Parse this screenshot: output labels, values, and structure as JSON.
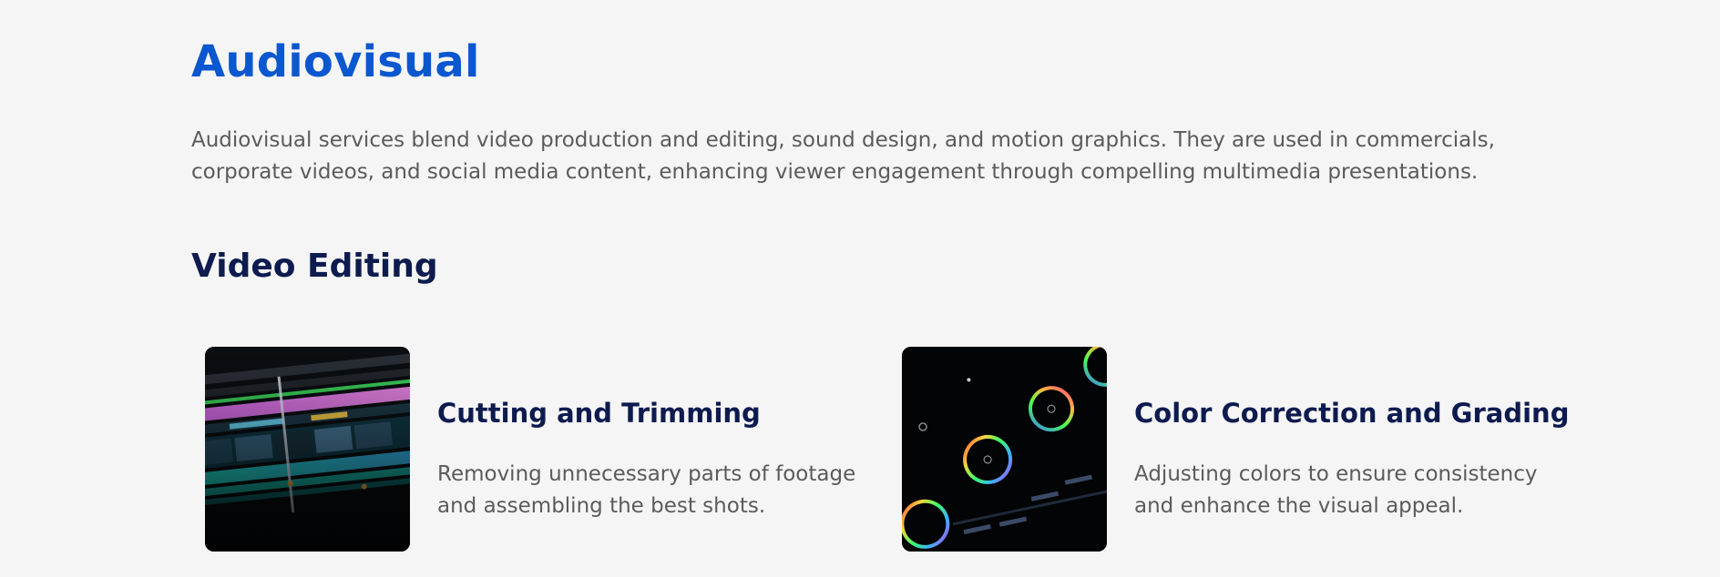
{
  "section": {
    "title": "Audiovisual",
    "description": "Audiovisual services blend video production and editing, sound design, and motion graphics. They are used in commercials, corporate videos, and social media content, enhancing viewer engagement through compelling multimedia presentations."
  },
  "subsection": {
    "title": "Video Editing"
  },
  "cards": [
    {
      "title": "Cutting and Trimming",
      "text": "Removing unnecessary parts of footage and assembling the best shots.",
      "image_icon": "timeline-editor-image"
    },
    {
      "title": "Color Correction and Grading",
      "text": "Adjusting colors to ensure consistency and enhance the visual appeal.",
      "image_icon": "color-wheels-image"
    }
  ],
  "colors": {
    "heading_blue": "#0b57d0",
    "heading_navy": "#0d1b4f",
    "body_text": "#5b5b5b",
    "background": "#f5f5f5"
  }
}
